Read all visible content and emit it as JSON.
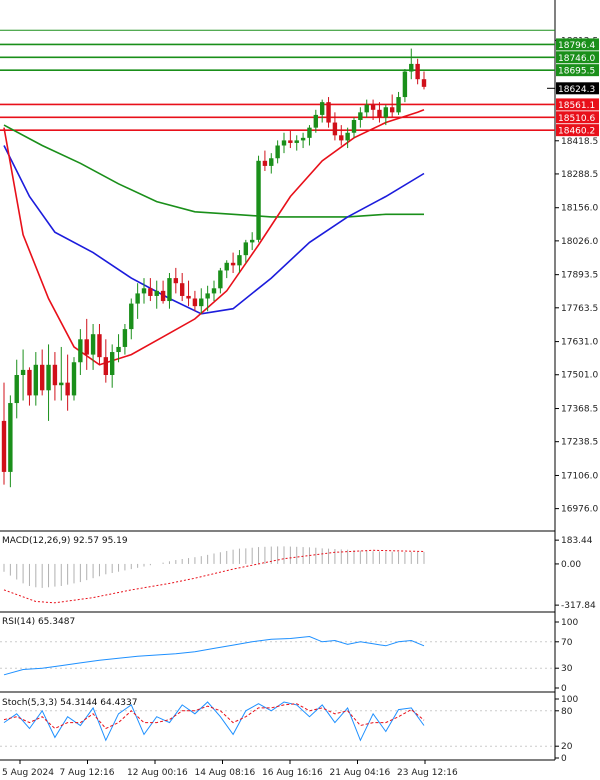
{
  "chart_data": [
    {
      "type": "candlestick",
      "panel": "price",
      "ylim": [
        16900,
        18900
      ],
      "y_ticks": [
        "18812.5",
        "18418.5",
        "18288.5",
        "18156.0",
        "18026.0",
        "17893.5",
        "17763.5",
        "17631.0",
        "17501.0",
        "17368.5",
        "17238.5",
        "17106.0",
        "16976.0"
      ],
      "price_badge": "18624.3",
      "resistance_levels": [
        {
          "label": "18796.4",
          "value": 18796.4,
          "color": "#1a8f1a"
        },
        {
          "label": "18746.0",
          "value": 18746.0,
          "color": "#1a8f1a"
        },
        {
          "label": "18695.5",
          "value": 18695.5,
          "color": "#1a8f1a"
        }
      ],
      "support_levels": [
        {
          "label": "18561.1",
          "value": 18561.1,
          "color": "#e8101a"
        },
        {
          "label": "18510.6",
          "value": 18510.6,
          "color": "#e8101a"
        },
        {
          "label": "18460.2",
          "value": 18460.2,
          "color": "#e8101a"
        }
      ],
      "top_line": 18852,
      "candles": [
        [
          17320,
          17470,
          17070,
          17120
        ],
        [
          17120,
          17420,
          17060,
          17390
        ],
        [
          17390,
          17560,
          17330,
          17500
        ],
        [
          17500,
          17600,
          17400,
          17520
        ],
        [
          17520,
          17530,
          17380,
          17420
        ],
        [
          17420,
          17590,
          17380,
          17540
        ],
        [
          17540,
          17600,
          17420,
          17440
        ],
        [
          17440,
          17620,
          17320,
          17540
        ],
        [
          17540,
          17590,
          17400,
          17460
        ],
        [
          17460,
          17610,
          17400,
          17470
        ],
        [
          17470,
          17580,
          17360,
          17420
        ],
        [
          17420,
          17570,
          17400,
          17550
        ],
        [
          17550,
          17680,
          17500,
          17640
        ],
        [
          17640,
          17720,
          17520,
          17580
        ],
        [
          17580,
          17700,
          17520,
          17660
        ],
        [
          17660,
          17700,
          17540,
          17570
        ],
        [
          17570,
          17640,
          17470,
          17500
        ],
        [
          17500,
          17620,
          17450,
          17590
        ],
        [
          17590,
          17660,
          17550,
          17610
        ],
        [
          17610,
          17700,
          17580,
          17680
        ],
        [
          17680,
          17800,
          17640,
          17780
        ],
        [
          17780,
          17860,
          17720,
          17820
        ],
        [
          17820,
          17880,
          17780,
          17840
        ],
        [
          17840,
          17880,
          17790,
          17810
        ],
        [
          17810,
          17870,
          17760,
          17830
        ],
        [
          17830,
          17870,
          17780,
          17790
        ],
        [
          17790,
          17900,
          17760,
          17880
        ],
        [
          17880,
          17920,
          17820,
          17860
        ],
        [
          17860,
          17900,
          17790,
          17810
        ],
        [
          17810,
          17870,
          17770,
          17800
        ],
        [
          17800,
          17830,
          17750,
          17770
        ],
        [
          17770,
          17840,
          17740,
          17800
        ],
        [
          17800,
          17850,
          17750,
          17820
        ],
        [
          17820,
          17870,
          17790,
          17840
        ],
        [
          17840,
          17920,
          17820,
          17910
        ],
        [
          17910,
          17950,
          17880,
          17940
        ],
        [
          17940,
          17980,
          17900,
          17930
        ],
        [
          17930,
          17990,
          17900,
          17970
        ],
        [
          17970,
          18030,
          17940,
          18020
        ],
        [
          18020,
          18060,
          17990,
          18030
        ],
        [
          18030,
          18360,
          18020,
          18340
        ],
        [
          18340,
          18380,
          18300,
          18320
        ],
        [
          18320,
          18370,
          18290,
          18350
        ],
        [
          18350,
          18420,
          18330,
          18400
        ],
        [
          18400,
          18450,
          18370,
          18420
        ],
        [
          18420,
          18460,
          18390,
          18410
        ],
        [
          18410,
          18440,
          18380,
          18420
        ],
        [
          18420,
          18450,
          18390,
          18430
        ],
        [
          18430,
          18480,
          18400,
          18470
        ],
        [
          18470,
          18540,
          18450,
          18520
        ],
        [
          18520,
          18580,
          18490,
          18570
        ],
        [
          18570,
          18590,
          18470,
          18490
        ],
        [
          18490,
          18530,
          18420,
          18440
        ],
        [
          18440,
          18480,
          18400,
          18420
        ],
        [
          18420,
          18470,
          18390,
          18450
        ],
        [
          18450,
          18510,
          18430,
          18500
        ],
        [
          18500,
          18550,
          18470,
          18530
        ],
        [
          18530,
          18580,
          18510,
          18560
        ],
        [
          18560,
          18580,
          18500,
          18540
        ],
        [
          18540,
          18570,
          18490,
          18510
        ],
        [
          18510,
          18560,
          18480,
          18550
        ],
        [
          18550,
          18600,
          18510,
          18530
        ],
        [
          18530,
          18610,
          18520,
          18590
        ],
        [
          18590,
          18700,
          18570,
          18690
        ],
        [
          18690,
          18780,
          18660,
          18720
        ],
        [
          18720,
          18740,
          18640,
          18660
        ],
        [
          18660,
          18690,
          18620,
          18630
        ]
      ],
      "ma_red": [
        [
          0,
          18470
        ],
        [
          3,
          18050
        ],
        [
          7,
          17800
        ],
        [
          11,
          17610
        ],
        [
          15,
          17540
        ],
        [
          20,
          17580
        ],
        [
          25,
          17650
        ],
        [
          30,
          17720
        ],
        [
          35,
          17830
        ],
        [
          40,
          18010
        ],
        [
          45,
          18200
        ],
        [
          50,
          18340
        ],
        [
          55,
          18430
        ],
        [
          60,
          18490
        ],
        [
          65,
          18530
        ],
        [
          66,
          18540
        ]
      ],
      "ma_blue": [
        [
          0,
          18400
        ],
        [
          4,
          18200
        ],
        [
          8,
          18060
        ],
        [
          14,
          17980
        ],
        [
          20,
          17880
        ],
        [
          26,
          17800
        ],
        [
          31,
          17740
        ],
        [
          36,
          17760
        ],
        [
          42,
          17880
        ],
        [
          48,
          18020
        ],
        [
          54,
          18120
        ],
        [
          60,
          18200
        ],
        [
          66,
          18290
        ]
      ],
      "ma_green": [
        [
          0,
          18480
        ],
        [
          6,
          18400
        ],
        [
          12,
          18330
        ],
        [
          18,
          18250
        ],
        [
          24,
          18180
        ],
        [
          30,
          18140
        ],
        [
          36,
          18130
        ],
        [
          42,
          18120
        ],
        [
          48,
          18120
        ],
        [
          54,
          18120
        ],
        [
          60,
          18130
        ],
        [
          66,
          18130
        ]
      ]
    },
    {
      "type": "bar",
      "panel": "macd",
      "label": "MACD(12,26,9) 92.57 95.19",
      "ylim": [
        -340,
        200
      ],
      "y_ticks": [
        "183.44",
        "0.00",
        "-317.84"
      ],
      "values": [
        -60,
        -90,
        -120,
        -150,
        -170,
        -180,
        -185,
        -180,
        -175,
        -170,
        -160,
        -150,
        -140,
        -125,
        -110,
        -95,
        -80,
        -70,
        -60,
        -50,
        -40,
        -30,
        -20,
        -10,
        0,
        10,
        20,
        30,
        38,
        45,
        52,
        60,
        70,
        80,
        90,
        100,
        110,
        118,
        120,
        125,
        130,
        132,
        134,
        135,
        135,
        134,
        132,
        130,
        128,
        125,
        120,
        118,
        115,
        112,
        110,
        106,
        102,
        100,
        98,
        96,
        95,
        94,
        93,
        92,
        92,
        92,
        93
      ],
      "signal": [
        [
          0,
          -200
        ],
        [
          5,
          -290
        ],
        [
          8,
          -300
        ],
        [
          14,
          -260
        ],
        [
          20,
          -200
        ],
        [
          26,
          -150
        ],
        [
          30,
          -110
        ],
        [
          36,
          -40
        ],
        [
          44,
          40
        ],
        [
          52,
          90
        ],
        [
          58,
          105
        ],
        [
          66,
          96
        ]
      ]
    },
    {
      "type": "line",
      "panel": "rsi",
      "label": "RSI(14) 65.3487",
      "ylim": [
        0,
        100
      ],
      "y_ticks": [
        "100",
        "70",
        "30",
        "0"
      ],
      "values": [
        [
          0,
          20
        ],
        [
          3,
          28
        ],
        [
          6,
          30
        ],
        [
          9,
          34
        ],
        [
          12,
          38
        ],
        [
          15,
          42
        ],
        [
          18,
          45
        ],
        [
          21,
          48
        ],
        [
          24,
          50
        ],
        [
          27,
          52
        ],
        [
          30,
          55
        ],
        [
          33,
          60
        ],
        [
          36,
          65
        ],
        [
          39,
          70
        ],
        [
          42,
          74
        ],
        [
          45,
          75
        ],
        [
          48,
          78
        ],
        [
          50,
          70
        ],
        [
          52,
          72
        ],
        [
          54,
          66
        ],
        [
          56,
          70
        ],
        [
          58,
          67
        ],
        [
          60,
          64
        ],
        [
          62,
          70
        ],
        [
          64,
          72
        ],
        [
          66,
          64
        ]
      ]
    },
    {
      "type": "line",
      "panel": "stoch",
      "label": "Stoch(5,3,3) 54.3144 64.4337",
      "ylim": [
        0,
        100
      ],
      "y_ticks": [
        "100",
        "80",
        "20",
        "0"
      ],
      "k": [
        [
          0,
          60
        ],
        [
          2,
          75
        ],
        [
          4,
          50
        ],
        [
          6,
          80
        ],
        [
          8,
          35
        ],
        [
          10,
          70
        ],
        [
          12,
          55
        ],
        [
          14,
          85
        ],
        [
          16,
          30
        ],
        [
          18,
          75
        ],
        [
          20,
          90
        ],
        [
          22,
          40
        ],
        [
          24,
          70
        ],
        [
          26,
          60
        ],
        [
          28,
          90
        ],
        [
          30,
          75
        ],
        [
          32,
          95
        ],
        [
          34,
          70
        ],
        [
          36,
          40
        ],
        [
          38,
          80
        ],
        [
          40,
          92
        ],
        [
          42,
          80
        ],
        [
          44,
          95
        ],
        [
          46,
          90
        ],
        [
          48,
          70
        ],
        [
          50,
          90
        ],
        [
          52,
          60
        ],
        [
          54,
          85
        ],
        [
          56,
          30
        ],
        [
          58,
          75
        ],
        [
          60,
          45
        ],
        [
          62,
          82
        ],
        [
          64,
          85
        ],
        [
          66,
          55
        ]
      ],
      "d": [
        [
          0,
          65
        ],
        [
          2,
          70
        ],
        [
          4,
          60
        ],
        [
          6,
          70
        ],
        [
          8,
          50
        ],
        [
          10,
          60
        ],
        [
          12,
          60
        ],
        [
          14,
          75
        ],
        [
          16,
          50
        ],
        [
          18,
          60
        ],
        [
          20,
          80
        ],
        [
          22,
          60
        ],
        [
          24,
          60
        ],
        [
          26,
          65
        ],
        [
          28,
          80
        ],
        [
          30,
          80
        ],
        [
          32,
          88
        ],
        [
          34,
          80
        ],
        [
          36,
          60
        ],
        [
          38,
          70
        ],
        [
          40,
          85
        ],
        [
          42,
          85
        ],
        [
          44,
          90
        ],
        [
          46,
          92
        ],
        [
          48,
          80
        ],
        [
          50,
          85
        ],
        [
          52,
          75
        ],
        [
          54,
          80
        ],
        [
          56,
          55
        ],
        [
          58,
          60
        ],
        [
          60,
          60
        ],
        [
          62,
          70
        ],
        [
          64,
          82
        ],
        [
          66,
          64
        ]
      ]
    }
  ],
  "x_axis_labels": [
    "5 Aug 2024",
    "7 Aug 12:16",
    "12 Aug 00:16",
    "14 Aug 08:16",
    "16 Aug 16:16",
    "21 Aug 04:16",
    "23 Aug 12:16"
  ]
}
